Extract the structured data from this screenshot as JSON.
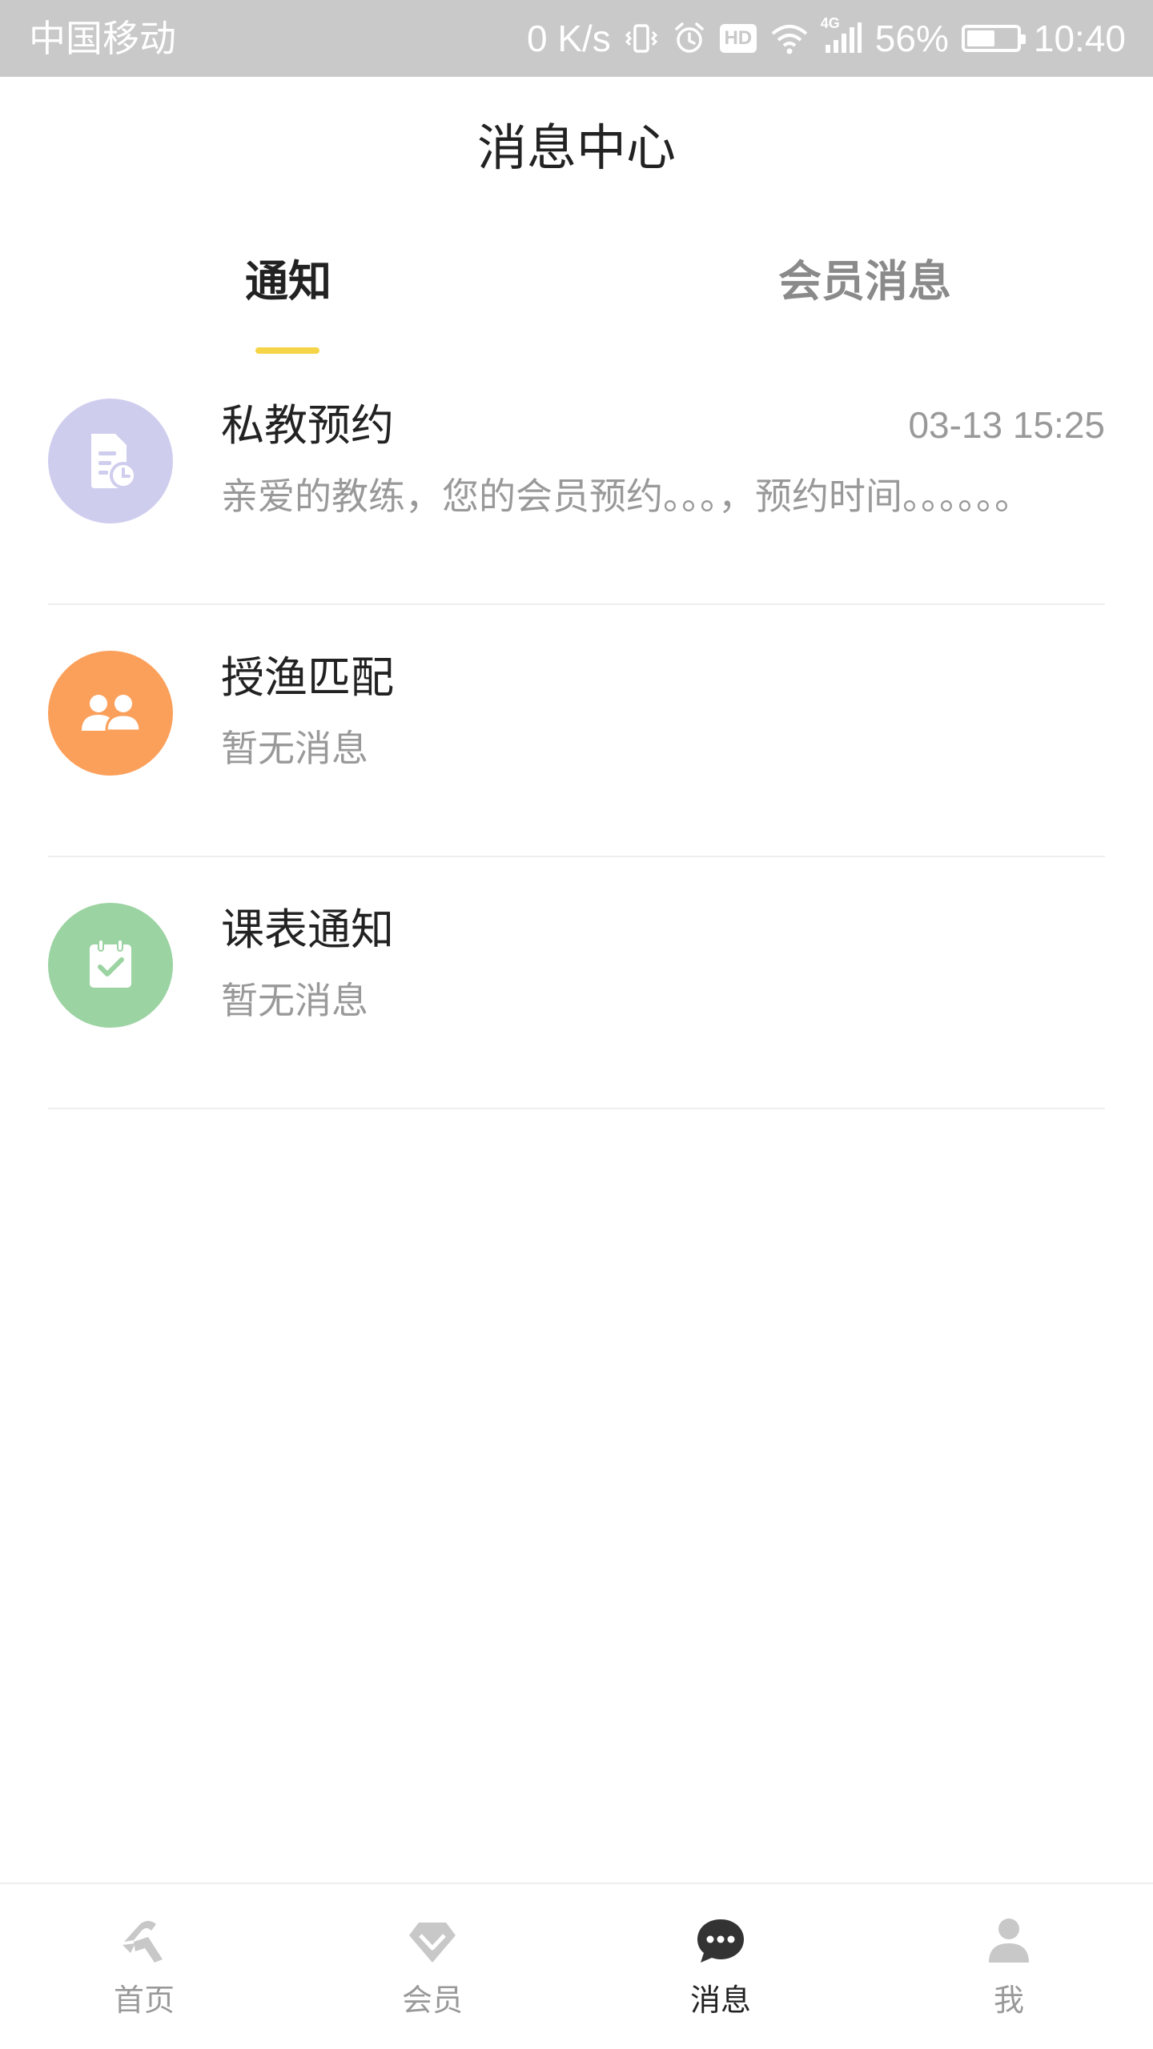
{
  "status_bar": {
    "carrier": "中国移动",
    "net_speed": "0 K/s",
    "hd": "HD",
    "network": "4G",
    "battery": "56%",
    "battery_level": 0.56,
    "time": "10:40"
  },
  "header": {
    "title": "消息中心"
  },
  "tabs": [
    {
      "label": "通知",
      "active": true
    },
    {
      "label": "会员消息",
      "active": false
    }
  ],
  "colors": {
    "tab_indicator": "#f5d547",
    "avatar_booking": "#cfcdee",
    "avatar_match": "#fba05b",
    "avatar_schedule": "#9bd3a2"
  },
  "messages": [
    {
      "title": "私教预约",
      "time": "03-13 15:25",
      "preview": "亲爱的教练，您的会员预约。。。，预约时间。。。。。。",
      "icon": "document-clock-icon"
    },
    {
      "title": "授渔匹配",
      "time": "",
      "preview": "暂无消息",
      "icon": "users-icon"
    },
    {
      "title": "课表通知",
      "time": "",
      "preview": "暂无消息",
      "icon": "calendar-check-icon"
    }
  ],
  "bottom_nav": [
    {
      "label": "首页",
      "icon": "home-logo-icon",
      "active": false
    },
    {
      "label": "会员",
      "icon": "diamond-icon",
      "active": false
    },
    {
      "label": "消息",
      "icon": "chat-bubble-icon",
      "active": true
    },
    {
      "label": "我",
      "icon": "person-icon",
      "active": false
    }
  ]
}
